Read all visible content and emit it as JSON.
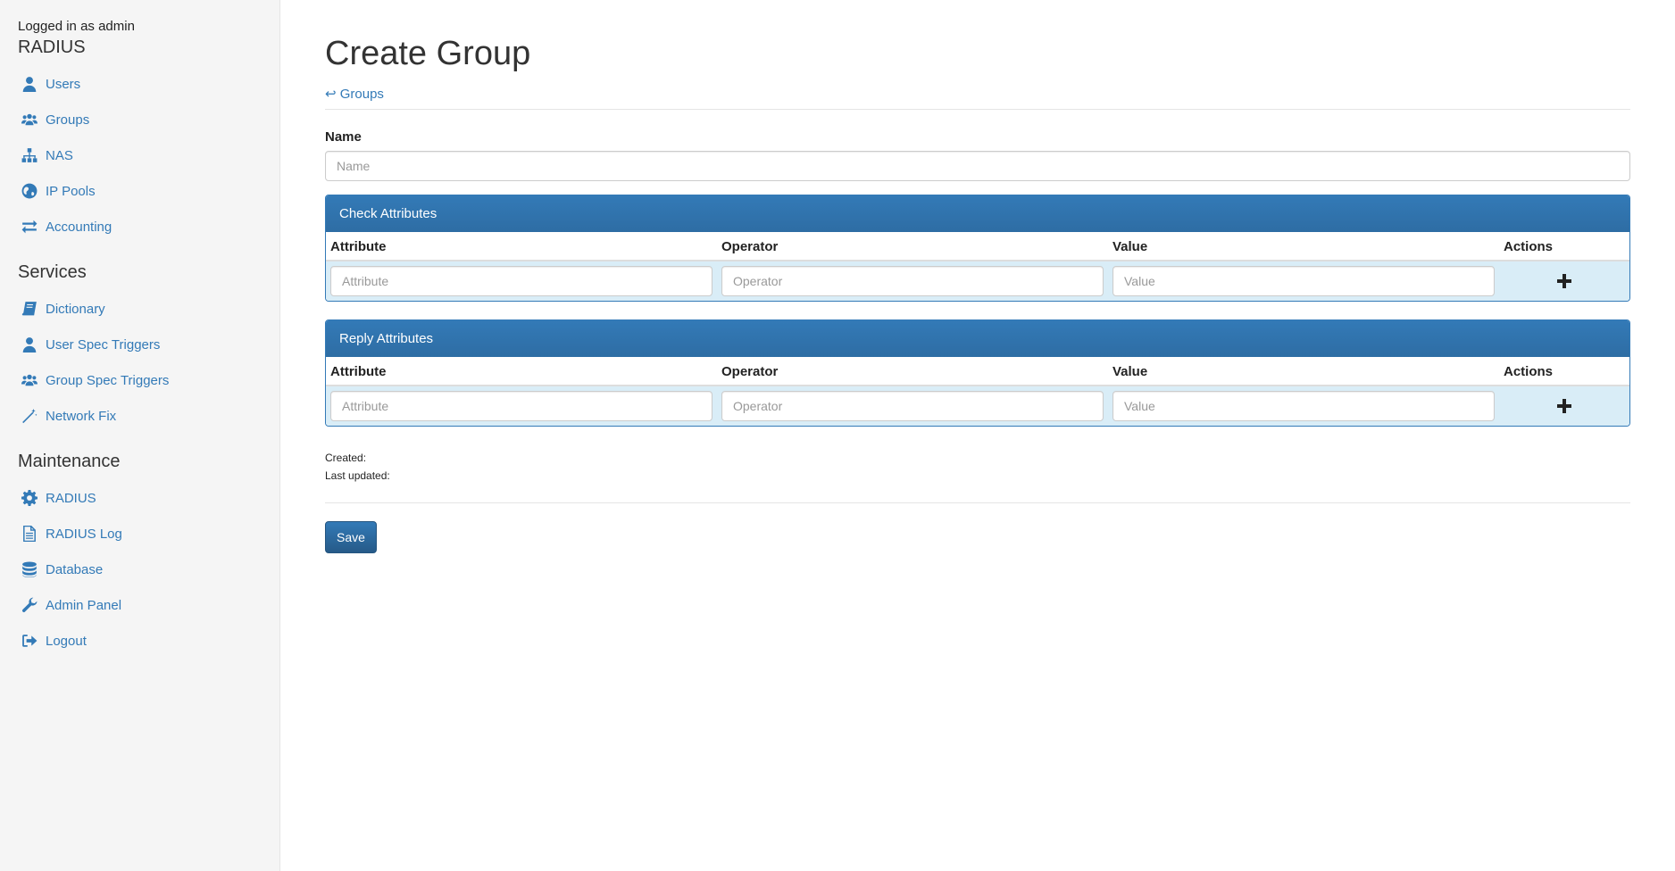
{
  "sidebar": {
    "logged_in": "Logged in as admin",
    "sections": [
      {
        "title": "RADIUS",
        "items": [
          {
            "label": "Users",
            "icon": "user-icon"
          },
          {
            "label": "Groups",
            "icon": "users-icon"
          },
          {
            "label": "NAS",
            "icon": "sitemap-icon"
          },
          {
            "label": "IP Pools",
            "icon": "globe-icon"
          },
          {
            "label": "Accounting",
            "icon": "exchange-icon"
          }
        ]
      },
      {
        "title": "Services",
        "items": [
          {
            "label": "Dictionary",
            "icon": "book-icon"
          },
          {
            "label": "User Spec Triggers",
            "icon": "user-icon"
          },
          {
            "label": "Group Spec Triggers",
            "icon": "users-icon"
          },
          {
            "label": "Network Fix",
            "icon": "magic-wand-icon"
          }
        ]
      },
      {
        "title": "Maintenance",
        "items": [
          {
            "label": "RADIUS",
            "icon": "gear-icon"
          },
          {
            "label": "RADIUS Log",
            "icon": "file-icon"
          },
          {
            "label": "Database",
            "icon": "database-icon"
          },
          {
            "label": "Admin Panel",
            "icon": "wrench-icon"
          },
          {
            "label": "Logout",
            "icon": "sign-out-icon"
          }
        ]
      }
    ]
  },
  "main": {
    "title": "Create Group",
    "back_link": "↩ Groups",
    "name_label": "Name",
    "name_placeholder": "Name",
    "check_panel": {
      "title": "Check Attributes",
      "columns": [
        "Attribute",
        "Operator",
        "Value",
        "Actions"
      ],
      "placeholders": [
        "Attribute",
        "Operator",
        "Value"
      ]
    },
    "reply_panel": {
      "title": "Reply Attributes",
      "columns": [
        "Attribute",
        "Operator",
        "Value",
        "Actions"
      ],
      "placeholders": [
        "Attribute",
        "Operator",
        "Value"
      ]
    },
    "created_label": "Created:",
    "updated_label": "Last updated:",
    "save_label": "Save"
  },
  "colors": {
    "accent": "#337ab7",
    "panel_row": "#d9edf7",
    "sidebar_bg": "#f5f5f5"
  }
}
